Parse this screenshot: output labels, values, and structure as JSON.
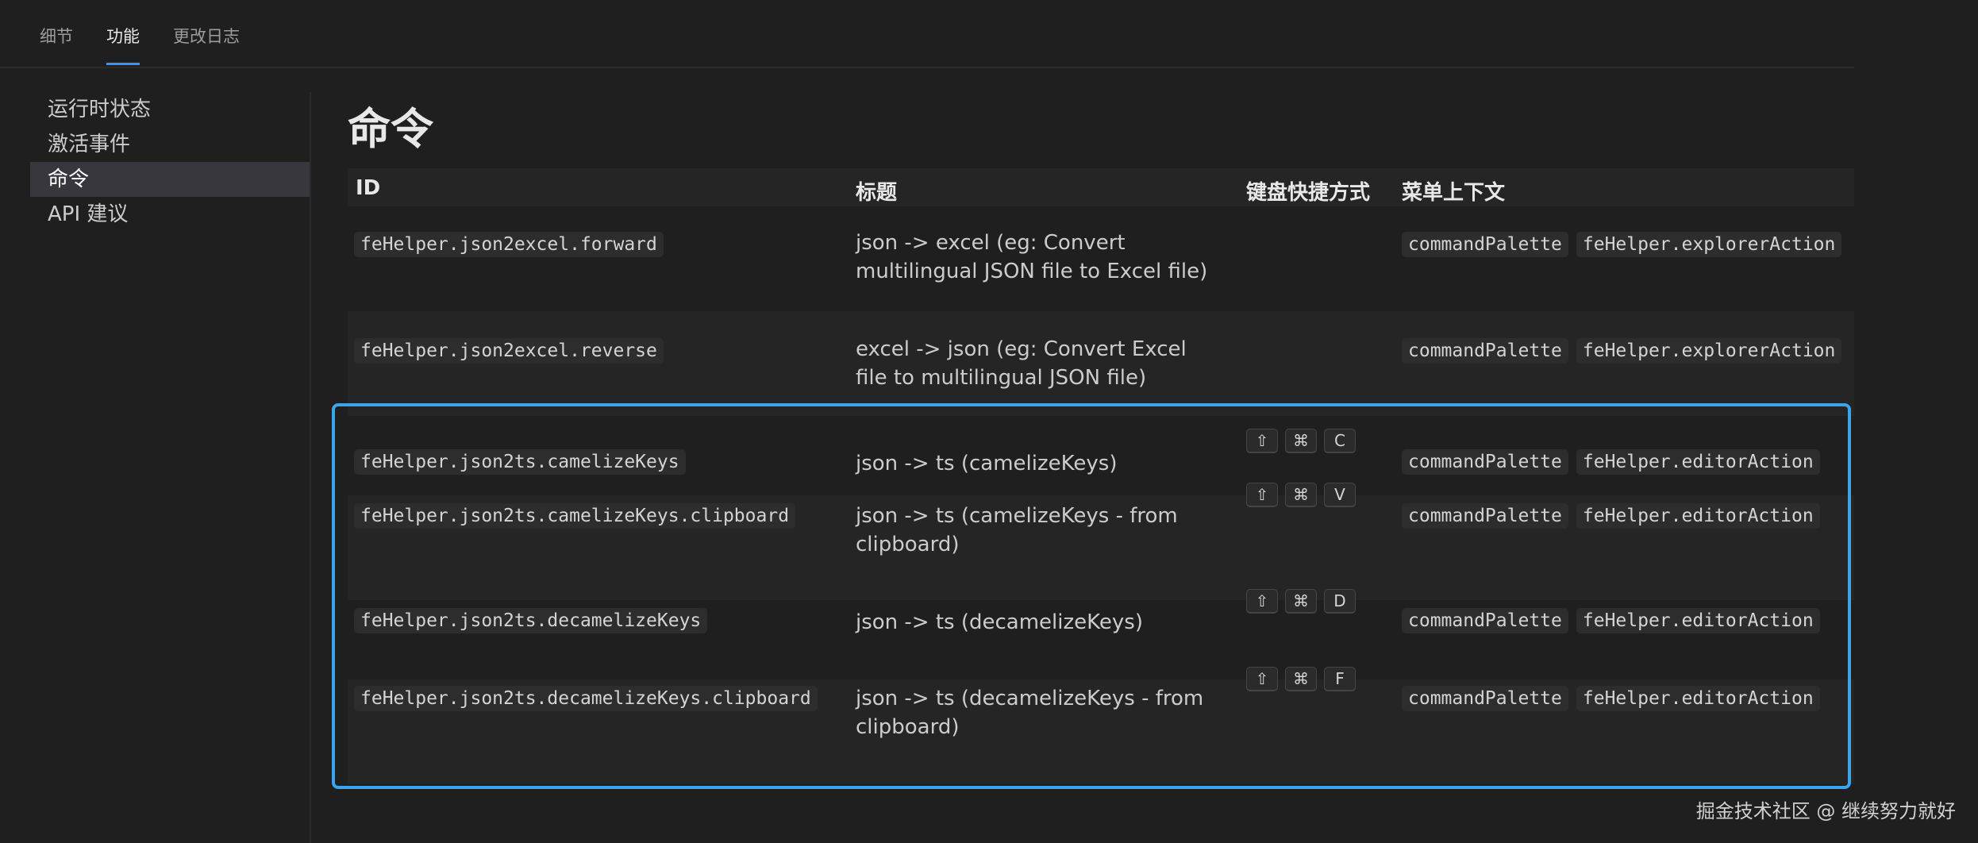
{
  "tabs": [
    {
      "label": "细节"
    },
    {
      "label": "功能"
    },
    {
      "label": "更改日志"
    }
  ],
  "sidebar": {
    "items": [
      {
        "label": "运行时状态"
      },
      {
        "label": "激活事件"
      },
      {
        "label": "命令"
      },
      {
        "label": "API 建议"
      }
    ]
  },
  "main": {
    "heading": "命令",
    "columns": {
      "id": "ID",
      "title": "标题",
      "keybinding": "键盘快捷方式",
      "menu": "菜单上下文"
    },
    "rows": [
      {
        "id": "feHelper.json2excel.forward",
        "title": "json -> excel (eg: Convert multilingual JSON file to Excel file)",
        "keys": [],
        "menus": [
          "commandPalette",
          "feHelper.explorerAction"
        ]
      },
      {
        "id": "feHelper.json2excel.reverse",
        "title": "excel -> json (eg: Convert Excel file to multilingual JSON file)",
        "keys": [],
        "menus": [
          "commandPalette",
          "feHelper.explorerAction"
        ]
      },
      {
        "id": "feHelper.json2ts.camelizeKeys",
        "title": "json -> ts (camelizeKeys)",
        "keys": [
          "⇧",
          "⌘",
          "C"
        ],
        "menus": [
          "commandPalette",
          "feHelper.editorAction"
        ]
      },
      {
        "id": "feHelper.json2ts.camelizeKeys.clipboard",
        "title": "json -> ts (camelizeKeys - from clipboard)",
        "keys": [
          "⇧",
          "⌘",
          "V"
        ],
        "menus": [
          "commandPalette",
          "feHelper.editorAction"
        ]
      },
      {
        "id": "feHelper.json2ts.decamelizeKeys",
        "title": "json -> ts (decamelizeKeys)",
        "keys": [
          "⇧",
          "⌘",
          "D"
        ],
        "menus": [
          "commandPalette",
          "feHelper.editorAction"
        ]
      },
      {
        "id": "feHelper.json2ts.decamelizeKeys.clipboard",
        "title": "json -> ts (decamelizeKeys - from clipboard)",
        "keys": [
          "⇧",
          "⌘",
          "F"
        ],
        "menus": [
          "commandPalette",
          "feHelper.editorAction"
        ]
      }
    ]
  },
  "watermark": "掘金技术社区 @ 继续努力就好",
  "colors": {
    "accent": "#3794ff",
    "highlight_border": "#3da3ea",
    "background": "#1f1f1f"
  }
}
